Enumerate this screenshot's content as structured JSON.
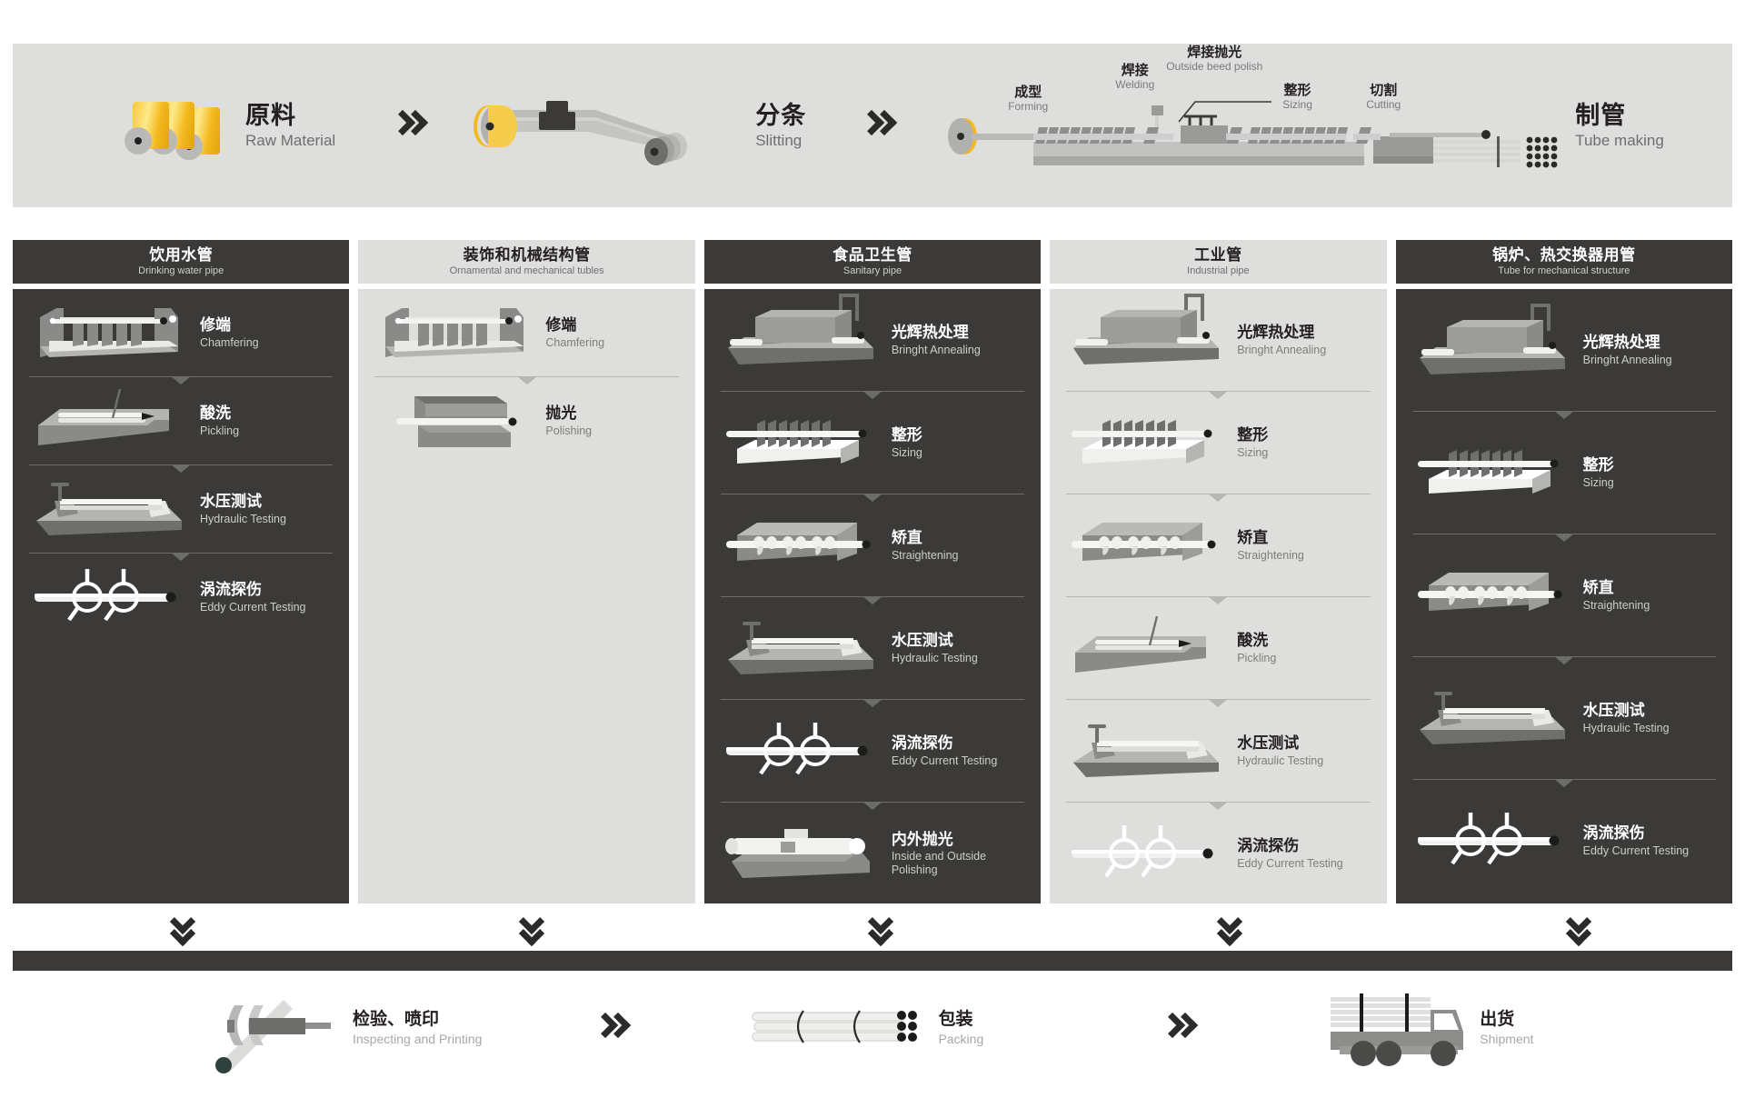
{
  "top_banner": {
    "stages": [
      {
        "cn": "原料",
        "en": "Raw Material",
        "icon": "steel-coils-icon"
      },
      {
        "cn": "分条",
        "en": "Slitting",
        "icon": "slitting-machine-icon"
      },
      {
        "cn": "制管",
        "en": "Tube making",
        "icon": "tube-mill-icon"
      }
    ],
    "tube_making_sublabels": [
      {
        "cn": "成型",
        "en": "Forming"
      },
      {
        "cn": "焊接",
        "en": "Welding"
      },
      {
        "cn": "焊接抛光",
        "en": "Outside beed polish"
      },
      {
        "cn": "整形",
        "en": "Sizing"
      },
      {
        "cn": "切割",
        "en": "Cutting"
      }
    ],
    "arrow_icon": "double-chevron-right-icon"
  },
  "columns": [
    {
      "theme": "dark",
      "cn": "饮用水管",
      "en": "Drinking water pipe",
      "steps": [
        {
          "cn": "修端",
          "en": "Chamfering",
          "icon": "chamfering-machine-icon"
        },
        {
          "cn": "酸洗",
          "en": "Pickling",
          "icon": "pickling-tank-icon"
        },
        {
          "cn": "水压测试",
          "en": "Hydraulic Testing",
          "icon": "hydraulic-tester-icon"
        },
        {
          "cn": "涡流探伤",
          "en": "Eddy Current Testing",
          "icon": "eddy-current-coil-icon"
        }
      ]
    },
    {
      "theme": "light",
      "cn": "装饰和机械结构管",
      "en": "Ornamental and mechanical tubles",
      "steps": [
        {
          "cn": "修端",
          "en": "Chamfering",
          "icon": "chamfering-machine-icon"
        },
        {
          "cn": "抛光",
          "en": "Polishing",
          "icon": "polishing-machine-icon"
        }
      ]
    },
    {
      "theme": "dark",
      "cn": "食品卫生管",
      "en": "Sanitary pipe",
      "steps": [
        {
          "cn": "光辉热处理",
          "en": "Bringht Annealing",
          "icon": "bright-annealing-furnace-icon"
        },
        {
          "cn": "整形",
          "en": "Sizing",
          "icon": "sizing-rollers-icon"
        },
        {
          "cn": "矫直",
          "en": "Straightening",
          "icon": "straightening-machine-icon"
        },
        {
          "cn": "水压测试",
          "en": "Hydraulic Testing",
          "icon": "hydraulic-tester-icon"
        },
        {
          "cn": "涡流探伤",
          "en": "Eddy Current Testing",
          "icon": "eddy-current-coil-icon"
        },
        {
          "cn": "内外抛光",
          "en": "Inside and Outside Polishing",
          "icon": "inside-outside-polisher-icon"
        }
      ]
    },
    {
      "theme": "light",
      "cn": "工业管",
      "en": "Industrial pipe",
      "steps": [
        {
          "cn": "光辉热处理",
          "en": "Bringht Annealing",
          "icon": "bright-annealing-furnace-icon"
        },
        {
          "cn": "整形",
          "en": "Sizing",
          "icon": "sizing-rollers-icon"
        },
        {
          "cn": "矫直",
          "en": "Straightening",
          "icon": "straightening-machine-icon"
        },
        {
          "cn": "酸洗",
          "en": "Pickling",
          "icon": "pickling-tank-icon"
        },
        {
          "cn": "水压测试",
          "en": "Hydraulic Testing",
          "icon": "hydraulic-tester-icon"
        },
        {
          "cn": "涡流探伤",
          "en": "Eddy Current Testing",
          "icon": "eddy-current-coil-icon"
        }
      ]
    },
    {
      "theme": "dark",
      "cn": "锅炉、热交换器用管",
      "en": "Tube for mechanical structure",
      "steps": [
        {
          "cn": "光辉热处理",
          "en": "Bringht Annealing",
          "icon": "bright-annealing-furnace-icon"
        },
        {
          "cn": "整形",
          "en": "Sizing",
          "icon": "sizing-rollers-icon"
        },
        {
          "cn": "矫直",
          "en": "Straightening",
          "icon": "straightening-machine-icon"
        },
        {
          "cn": "水压测试",
          "en": "Hydraulic Testing",
          "icon": "hydraulic-tester-icon"
        },
        {
          "cn": "涡流探伤",
          "en": "Eddy Current Testing",
          "icon": "eddy-current-coil-icon"
        }
      ]
    }
  ],
  "column_arrow_icon": "double-chevron-down-icon",
  "bottom_row": {
    "stages": [
      {
        "cn": "检验、喷印",
        "en": "Inspecting and Printing",
        "icon": "caliper-icon"
      },
      {
        "cn": "包装",
        "en": "Packing",
        "icon": "tube-bundle-icon"
      },
      {
        "cn": "出货",
        "en": "Shipment",
        "icon": "delivery-truck-icon"
      }
    ],
    "arrow_icon": "double-chevron-right-icon"
  },
  "colors": {
    "dark_panel": "#3b3a38",
    "light_panel": "#dededc",
    "accent_gold": "#f3b91d",
    "metal_light": "#e9e9e7",
    "metal_mid": "#b4b4b2",
    "metal_dark": "#8a8a88",
    "ink": "#231f20"
  }
}
